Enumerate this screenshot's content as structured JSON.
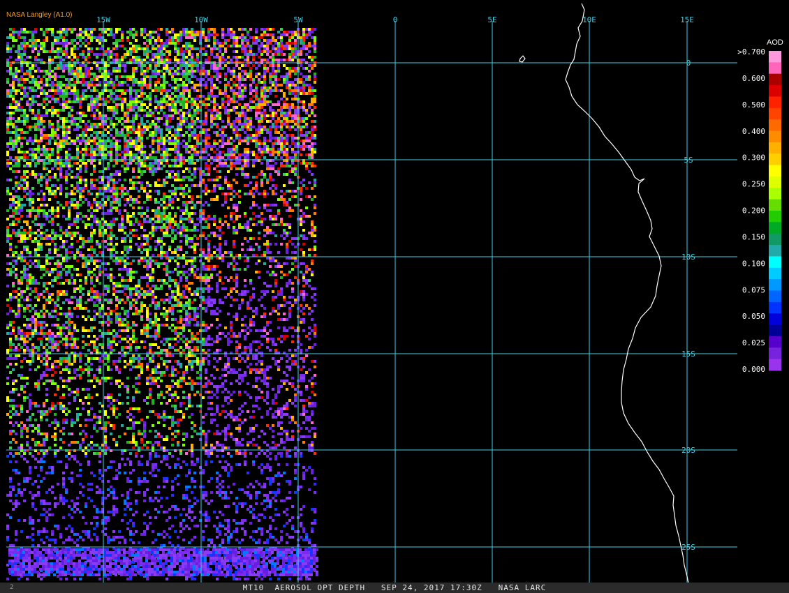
{
  "header": {
    "source_label": "NASA Langley (A1.0)"
  },
  "footer": {
    "caption": "MT10  AEROSOL OPT DEPTH   SEP 24, 2017 17:30Z   NASA LARC",
    "small_mark": "2"
  },
  "grid": {
    "longitude_labels": [
      "15W",
      "10W",
      "5W",
      "0",
      "5E",
      "10E",
      "15E"
    ],
    "latitude_labels": [
      "0",
      "5S",
      "10S",
      "15S",
      "20S",
      "25S"
    ],
    "line_color": "#3fd0e6"
  },
  "legend": {
    "title": "AOD",
    "tick_labels": [
      ">0.700",
      "0.600",
      "0.500",
      "0.400",
      "0.300",
      "0.250",
      "0.200",
      "0.150",
      "0.100",
      "0.075",
      "0.050",
      "0.025",
      "0.000"
    ],
    "colors_top_to_bottom": [
      "#ff99dd",
      "#ff66bb",
      "#aa0000",
      "#dd0000",
      "#ff2200",
      "#ff4400",
      "#ff6a00",
      "#ff8c00",
      "#ffb000",
      "#ffd000",
      "#ffff00",
      "#ddff00",
      "#aaff00",
      "#66dd00",
      "#22cc00",
      "#00aa22",
      "#119966",
      "#22aaaa",
      "#00ffff",
      "#00ccff",
      "#0099ff",
      "#0066ff",
      "#0033ff",
      "#0000dd",
      "#000099",
      "#5500cc",
      "#7722dd",
      "#9933ee"
    ]
  },
  "data_colors": {
    "low_aod": [
      "#7a2df0",
      "#8a3cf5",
      "#6a1fe0"
    ],
    "medium_aod": [
      "#1fb31f",
      "#7dff00",
      "#ffff00",
      "#3fd04f",
      "#20a8a0"
    ],
    "high_aod": [
      "#ff2a00",
      "#ff7a00",
      "#ffb000",
      "#ff66cc",
      "#d00000"
    ],
    "blue_aod": [
      "#0a3cff",
      "#0078ff",
      "#2b2bff"
    ],
    "coastline": "#ffffff"
  }
}
